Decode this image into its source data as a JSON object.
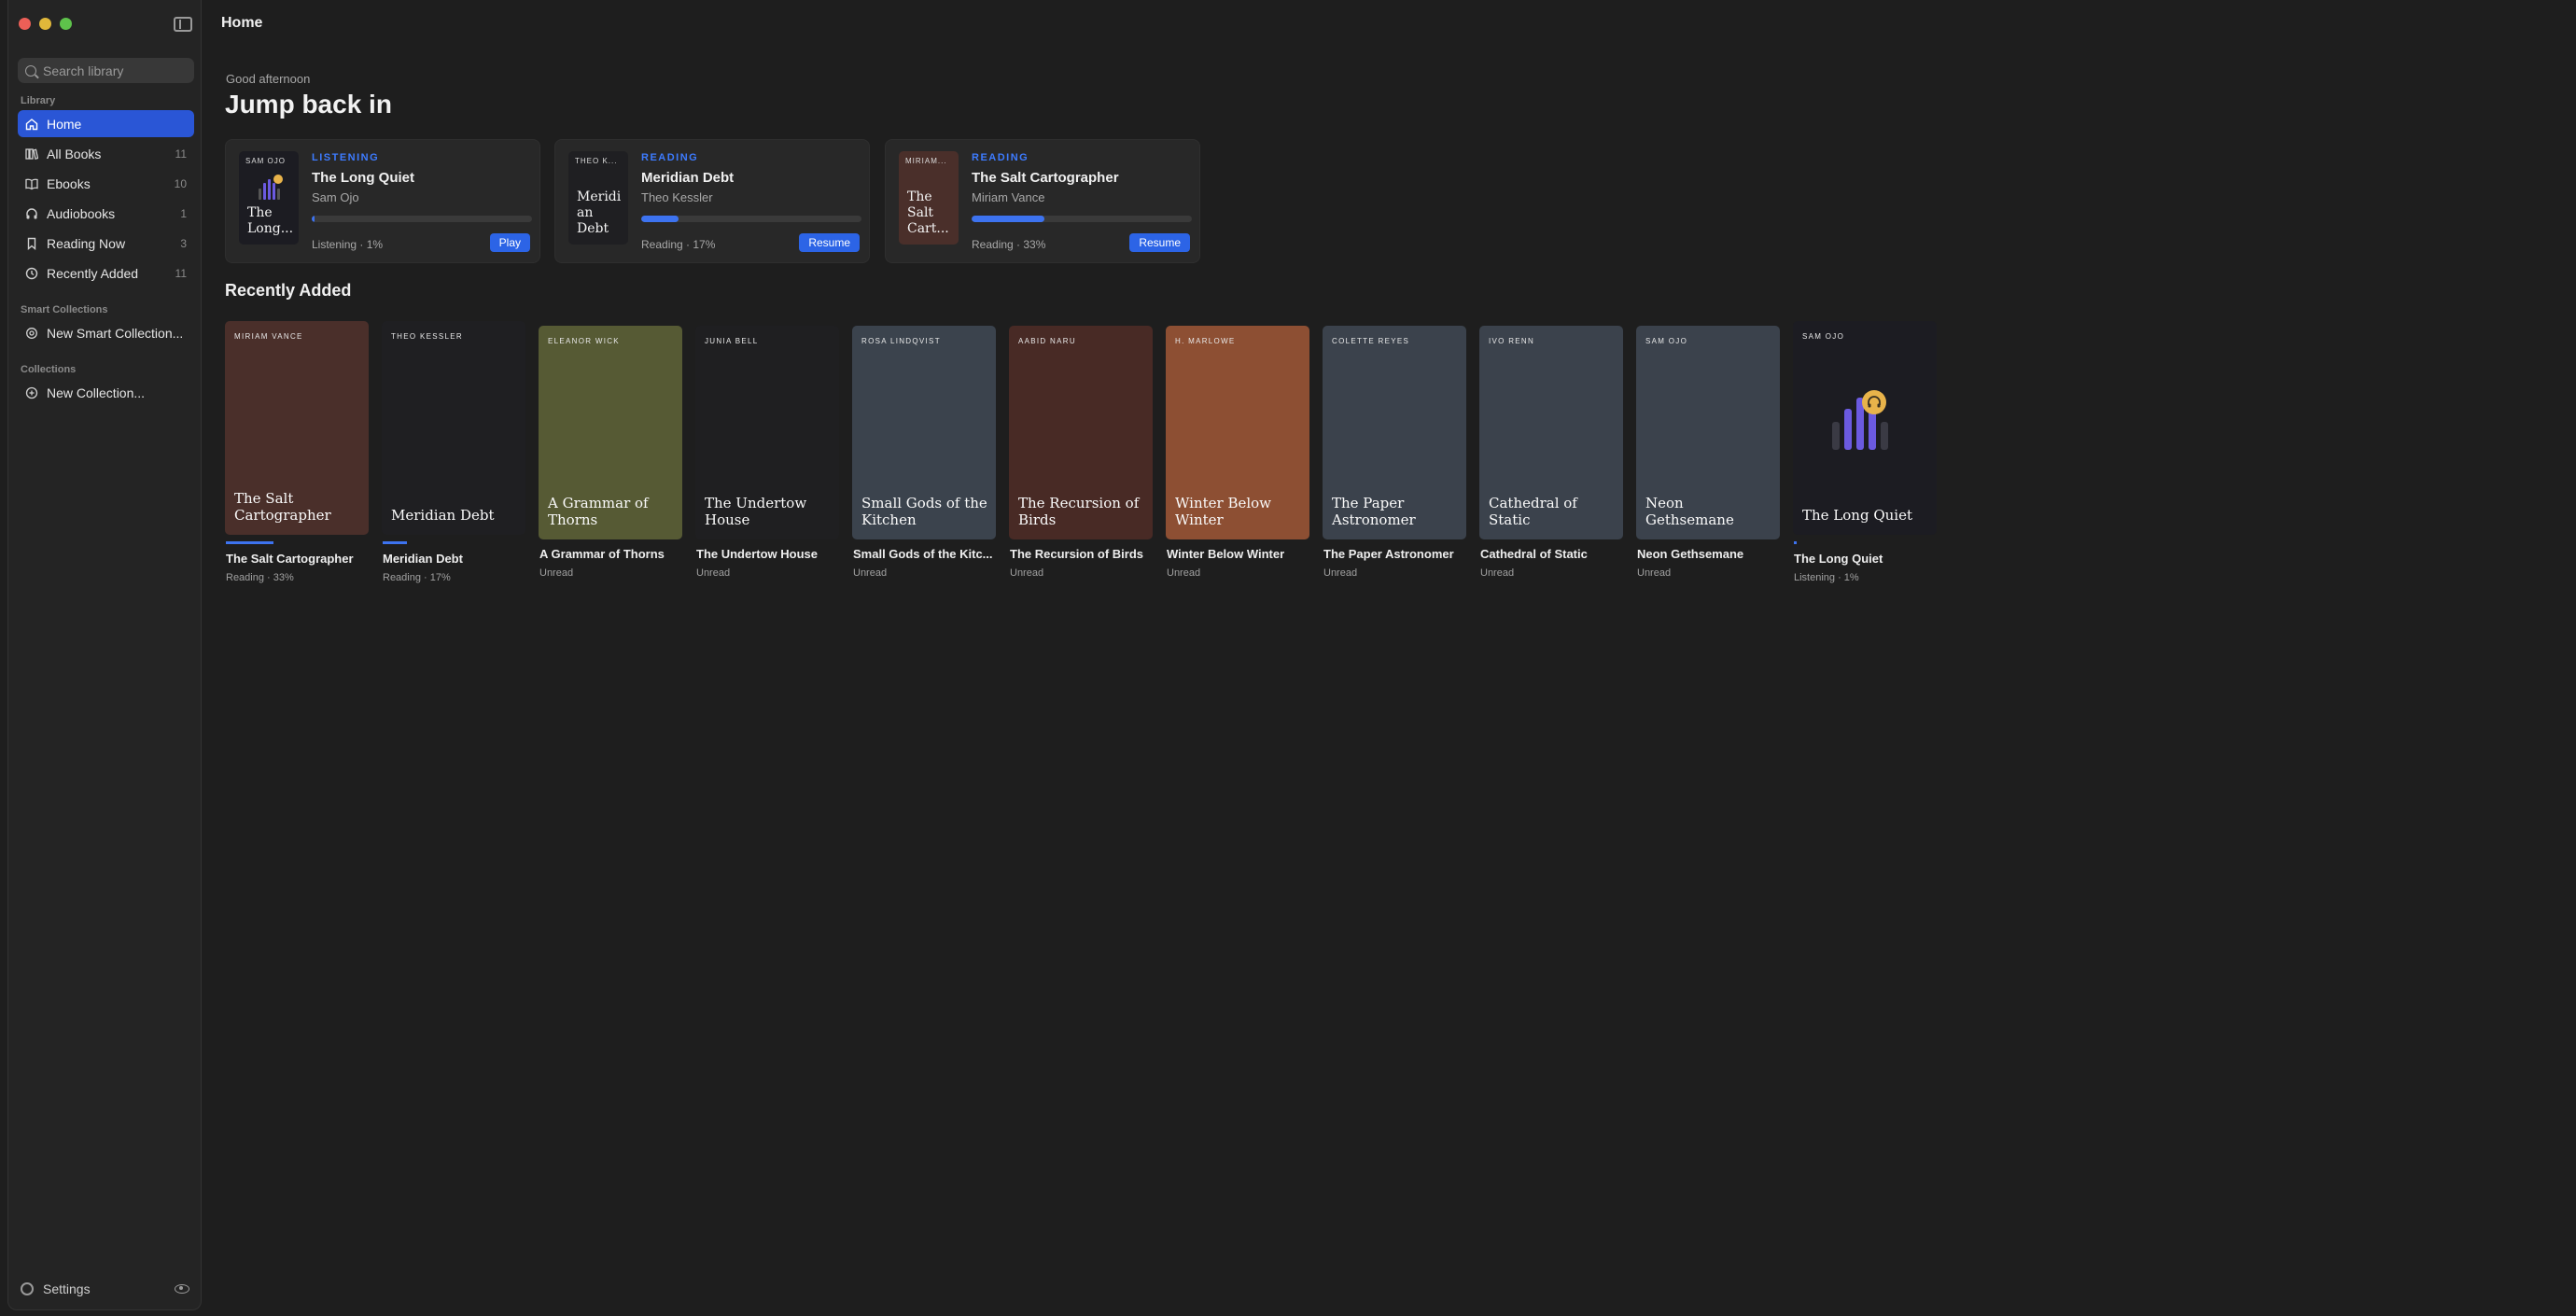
{
  "window": {
    "title": "Home"
  },
  "sidebar": {
    "search_placeholder": "Search library",
    "library_label": "Library",
    "items": [
      {
        "label": "Home",
        "count": "",
        "icon": "home-icon"
      },
      {
        "label": "All Books",
        "count": "11",
        "icon": "books-icon"
      },
      {
        "label": "Ebooks",
        "count": "10",
        "icon": "book-open-icon"
      },
      {
        "label": "Audiobooks",
        "count": "1",
        "icon": "headphones-icon"
      },
      {
        "label": "Reading Now",
        "count": "3",
        "icon": "bookmark-icon"
      },
      {
        "label": "Recently Added",
        "count": "11",
        "icon": "clock-icon"
      }
    ],
    "smart_collections_label": "Smart Collections",
    "new_smart_collection": "New Smart Collection...",
    "collections_label": "Collections",
    "new_collection": "New Collection...",
    "settings_label": "Settings"
  },
  "main": {
    "greeting": "Good afternoon",
    "headline": "Jump back in",
    "jump_back": [
      {
        "cover_author": "SAM OJO",
        "cover_title": "The Long...",
        "kind": "LISTENING",
        "title": "The Long Quiet",
        "author": "Sam Ojo",
        "progress": 0.01,
        "status": "Listening · 1%",
        "action": "Play",
        "cover_color": "#1c1c22"
      },
      {
        "cover_author": "THEO K...",
        "cover_title": "Meridi an Debt",
        "kind": "READING",
        "title": "Meridian Debt",
        "author": "Theo Kessler",
        "progress": 0.17,
        "status": "Reading · 17%",
        "action": "Resume",
        "cover_color": "#1f1f22"
      },
      {
        "cover_author": "MIRIAM...",
        "cover_title": "The Salt Cart...",
        "kind": "READING",
        "title": "The Salt Cartographer",
        "author": "Miriam Vance",
        "progress": 0.33,
        "status": "Reading · 33%",
        "action": "Resume",
        "cover_color": "#4a2f2a"
      }
    ],
    "recently_added_title": "Recently Added",
    "recently_added": [
      {
        "author": "MIRIAM VANCE",
        "cover_title": "The Salt Cartographer",
        "title": "The Salt Cartographer",
        "status": "Reading · 33%",
        "progress": 0.33,
        "color": "#4a2f2a"
      },
      {
        "author": "THEO KESSLER",
        "cover_title": "Meridian Debt",
        "title": "Meridian Debt",
        "status": "Reading · 17%",
        "progress": 0.17,
        "color": "#1f1f22"
      },
      {
        "author": "ELEANOR WICK",
        "cover_title": "A Grammar of Thorns",
        "title": "A Grammar of Thorns",
        "status": "Unread",
        "progress": 0,
        "color": "#565a34"
      },
      {
        "author": "JUNIA BELL",
        "cover_title": "The Undertow House",
        "title": "The Undertow House",
        "status": "Unread",
        "progress": 0,
        "color": "#1f1f21"
      },
      {
        "author": "ROSA LINDQVIST",
        "cover_title": "Small Gods of the Kitchen",
        "title": "Small Gods of the Kitc...",
        "status": "Unread",
        "progress": 0,
        "color": "#3b434d"
      },
      {
        "author": "AABID NARU",
        "cover_title": "The Recursion of Birds",
        "title": "The Recursion of Birds",
        "status": "Unread",
        "progress": 0,
        "color": "#482a25"
      },
      {
        "author": "H. MARLOWE",
        "cover_title": "Winter Below Winter",
        "title": "Winter Below Winter",
        "status": "Unread",
        "progress": 0,
        "color": "#8d4f33"
      },
      {
        "author": "COLETTE REYES",
        "cover_title": "The Paper Astronomer",
        "title": "The Paper Astronomer",
        "status": "Unread",
        "progress": 0,
        "color": "#3b424c"
      },
      {
        "author": "IVO RENN",
        "cover_title": "Cathedral of Static",
        "title": "Cathedral of Static",
        "status": "Unread",
        "progress": 0,
        "color": "#3b424c"
      },
      {
        "author": "SAM OJO",
        "cover_title": "Neon Gethsemane",
        "title": "Neon Gethsemane",
        "status": "Unread",
        "progress": 0,
        "color": "#3b424c"
      },
      {
        "author": "SAM OJO",
        "cover_title": "The Long Quiet",
        "title": "The Long Quiet",
        "status": "Listening · 1%",
        "progress": 0.01,
        "color": "#1c1c22"
      }
    ]
  },
  "colors": {
    "accent": "#2a56d6",
    "progress": "#3d73f0",
    "kind_label": "#3d7bff"
  }
}
